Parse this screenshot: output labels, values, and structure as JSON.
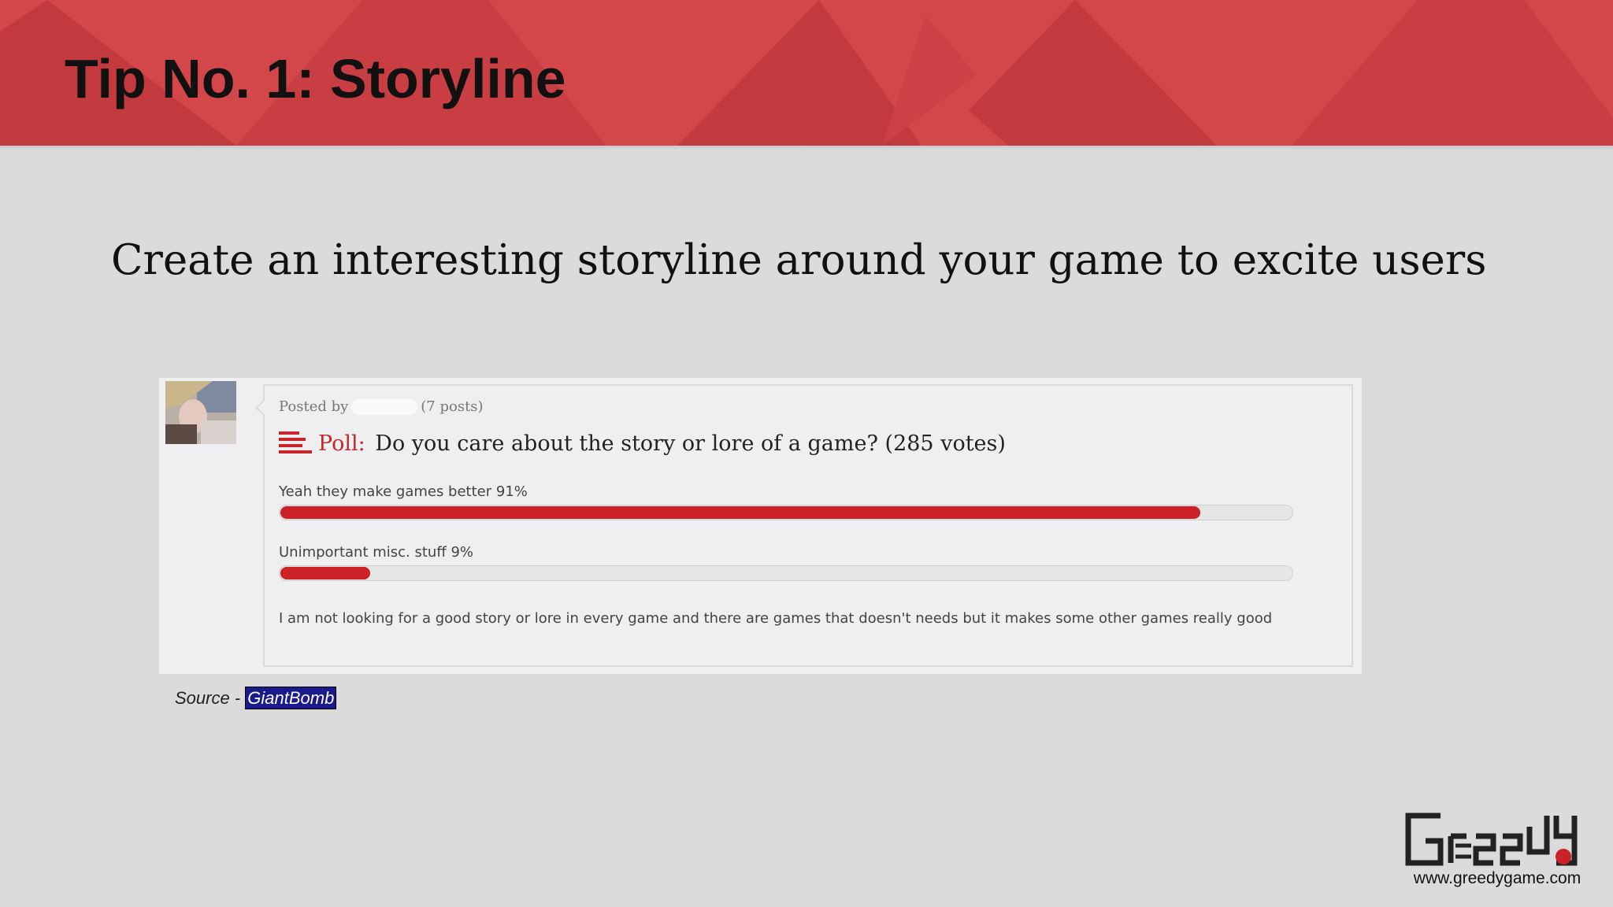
{
  "slide": {
    "title": "Tip No. 1: Storyline",
    "subtitle": "Create an interesting storyline around your game to excite users"
  },
  "post": {
    "posted_by_label": "Posted by",
    "post_count": "(7 posts)",
    "poll_label": "Poll:",
    "poll_question": "Do you care about the story or lore of a game? (285 votes)",
    "options": [
      {
        "label": "Yeah they make games better 91%",
        "percent": 91
      },
      {
        "label": "Unimportant misc. stuff 9%",
        "percent": 9
      }
    ],
    "comment": "I am not looking for a good story or lore in every game and there are games that doesn't needs but it makes some other games really good"
  },
  "source": {
    "prefix": "Source - ",
    "link": "GiantBomb"
  },
  "logo": {
    "url": "www.greedygame.com"
  },
  "colors": {
    "header": "#d3474b",
    "accent": "#cc2127",
    "background": "#dcdbdc"
  }
}
